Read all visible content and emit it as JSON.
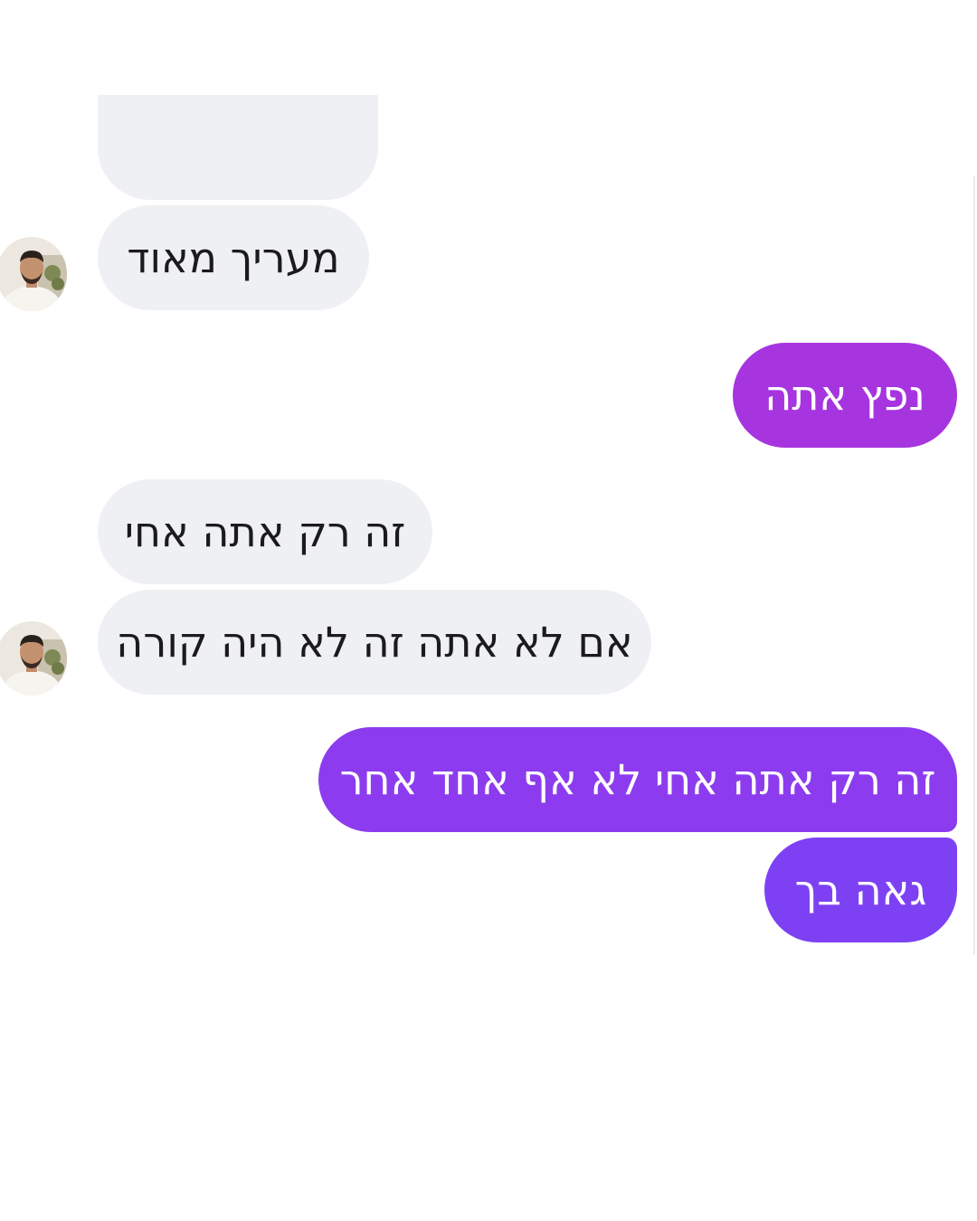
{
  "conversation": {
    "messages": [
      {
        "sender": "contact",
        "text": ""
      },
      {
        "sender": "contact",
        "text": "מעריך מאוד"
      },
      {
        "sender": "me",
        "text": "נפץ אתה"
      },
      {
        "sender": "contact",
        "text": "זה רק אתה אחי"
      },
      {
        "sender": "contact",
        "text": "אם לא אתה זה לא היה קורה"
      },
      {
        "sender": "me",
        "text": "זה רק אתה אחי לא אף אחד אחר"
      },
      {
        "sender": "me",
        "text": "גאה בך"
      }
    ],
    "contact_avatar_icon": "person-avatar-icon",
    "colors": {
      "incoming_bubble": "#eff0f3",
      "incoming_text": "#1b1b1f",
      "outgoing_gradient_top": "#a334e2",
      "outgoing_gradient_bottom": "#7b40f4",
      "outgoing_text": "#ffffff"
    }
  }
}
